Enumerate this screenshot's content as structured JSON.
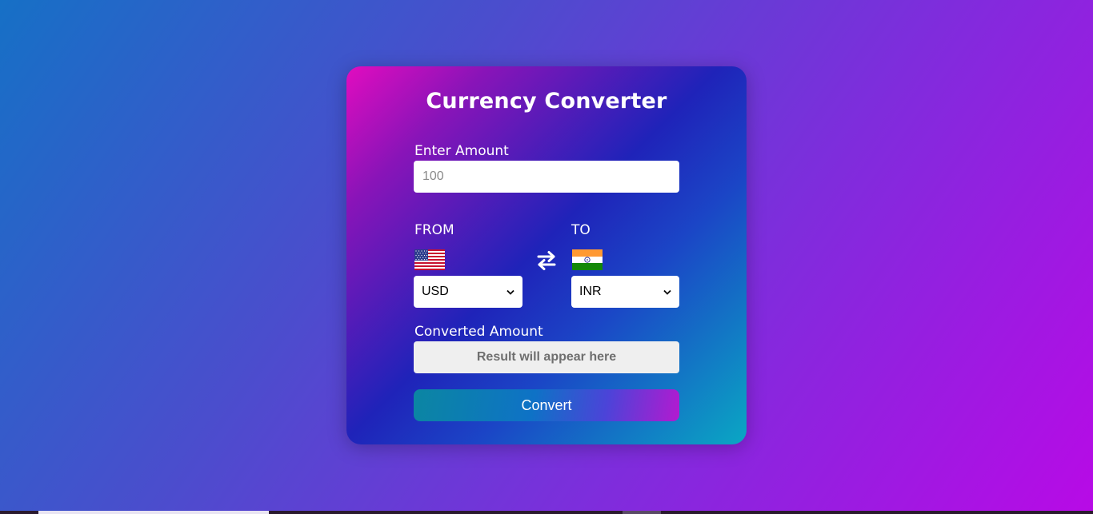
{
  "app": {
    "title": "Currency Converter"
  },
  "amount": {
    "label": "Enter Amount",
    "placeholder": "100",
    "value": ""
  },
  "from": {
    "label": "FROM",
    "flag_icon": "us-flag-icon",
    "selected": "USD"
  },
  "to": {
    "label": "TO",
    "flag_icon": "india-flag-icon",
    "selected": "INR"
  },
  "swap": {
    "icon": "swap-arrows-icon"
  },
  "result": {
    "label": "Converted Amount",
    "placeholder": "Result will appear here"
  },
  "convert": {
    "label": "Convert"
  },
  "colors": {
    "page_gradient": [
      "#1670c6",
      "#7e2ddc",
      "#b80ae6"
    ],
    "card_gradient": [
      "#e10cbf",
      "#1f23b9",
      "#0aa7c4"
    ],
    "button_gradient": [
      "#0b86a2",
      "#0e72c6",
      "#b31ad0"
    ],
    "result_bg": "#efefef",
    "text_light": "#ffffff"
  }
}
